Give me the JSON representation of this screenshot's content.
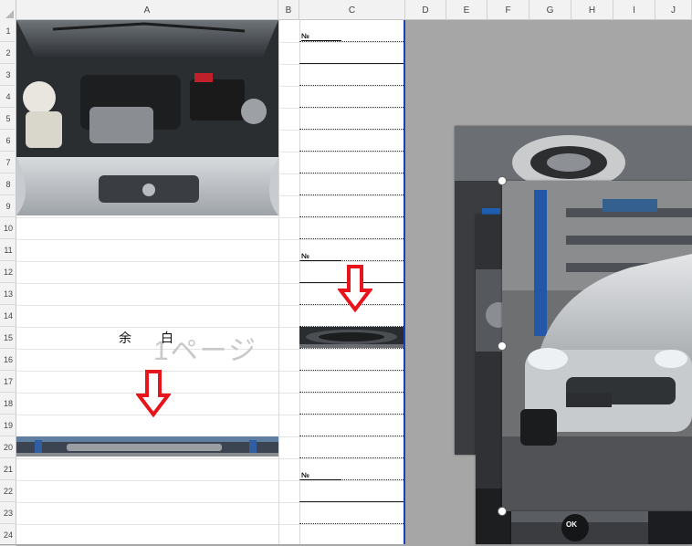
{
  "columns": [
    {
      "label": "A"
    },
    {
      "label": "B"
    },
    {
      "label": "C"
    },
    {
      "label": "D"
    },
    {
      "label": "E"
    },
    {
      "label": "F"
    },
    {
      "label": "G"
    },
    {
      "label": "H"
    },
    {
      "label": "I"
    },
    {
      "label": "J"
    }
  ],
  "rows": [
    "1",
    "2",
    "3",
    "4",
    "5",
    "6",
    "7",
    "8",
    "9",
    "10",
    "11",
    "12",
    "13",
    "14",
    "15",
    "16",
    "17",
    "18",
    "19",
    "20",
    "21",
    "22",
    "23",
    "24"
  ],
  "sheet": {
    "no_labels": [
      "№",
      "№",
      "№"
    ],
    "watermark": "1ページ",
    "margin_char_1": "余",
    "margin_char_2": "白"
  },
  "floating_ok_button": "OK",
  "colors": {
    "page_border": "#1a3fb8",
    "arrow": "#e8141c",
    "background": "#a6a6a6"
  },
  "icons": [
    "engine-bay-photo",
    "car-underbody-photo",
    "wheel-hub-photo",
    "silver-car-photo",
    "red-down-arrow-icon"
  ]
}
